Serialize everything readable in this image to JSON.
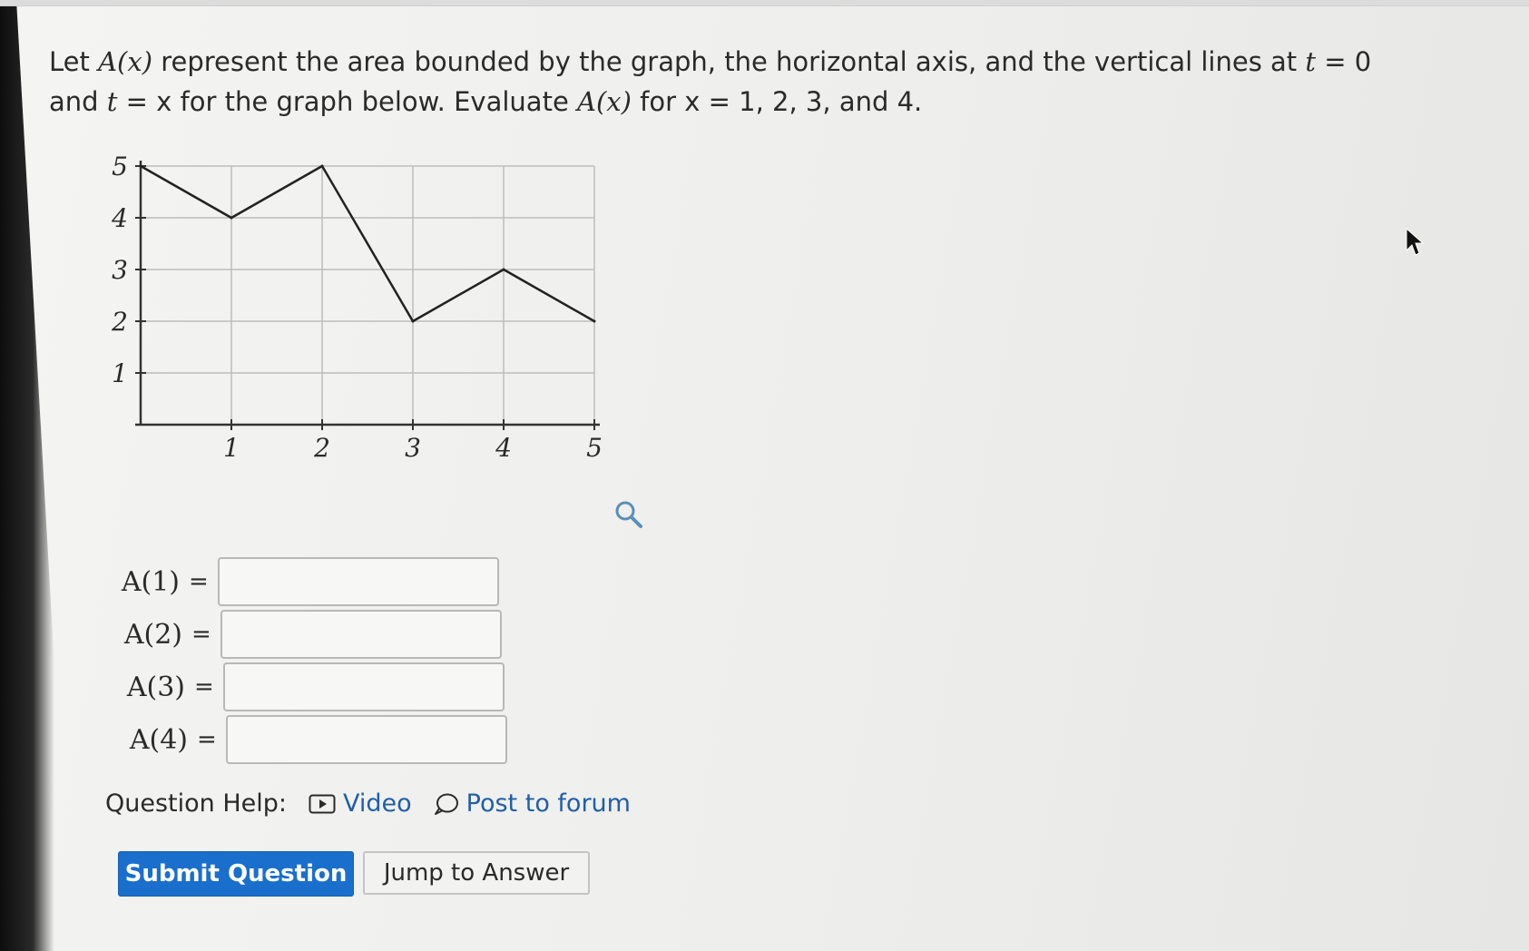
{
  "question": {
    "p1": "Let ",
    "m1": "A(x)",
    "p2": " represent the area bounded by the graph, the horizontal axis, and the vertical lines at ",
    "m2": "t",
    "p3": " = 0 and ",
    "m3": "t",
    "p4": " = x for the graph below. Evaluate ",
    "m4": "A(x)",
    "p5": " for x = 1, 2, 3, and 4."
  },
  "chart_data": {
    "type": "line",
    "x": [
      0,
      1,
      2,
      3,
      4,
      5
    ],
    "y": [
      5,
      4,
      5,
      2,
      3,
      2
    ],
    "xlim": [
      0,
      5
    ],
    "ylim": [
      0,
      5
    ],
    "xticks": [
      "1",
      "2",
      "3",
      "4",
      "5"
    ],
    "yticks": [
      "1",
      "2",
      "3",
      "4",
      "5"
    ],
    "grid": true
  },
  "answers": [
    {
      "label": "A(1)",
      "eq": "=",
      "value": ""
    },
    {
      "label": "A(2)",
      "eq": "=",
      "value": ""
    },
    {
      "label": "A(3)",
      "eq": "=",
      "value": ""
    },
    {
      "label": "A(4)",
      "eq": "=",
      "value": ""
    }
  ],
  "help": {
    "label": "Question Help:",
    "video": "Video",
    "forum": "Post to forum"
  },
  "buttons": {
    "submit": "Submit Question",
    "jump": "Jump to Answer"
  },
  "colors": {
    "accent": "#1a6fcc",
    "link": "#1f5fa8"
  },
  "icons": {
    "zoom": "magnifier-icon",
    "video": "video-icon",
    "forum": "speech-bubble-icon",
    "cursor": "mouse-pointer-icon"
  }
}
